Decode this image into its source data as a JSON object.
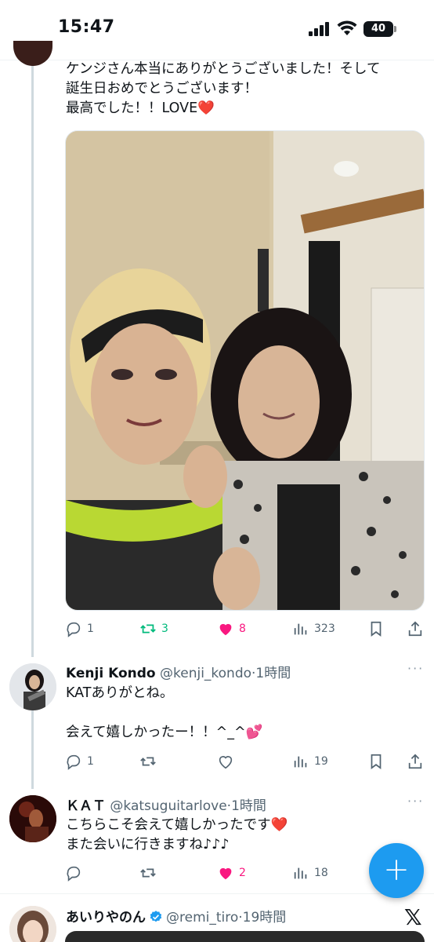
{
  "status_bar": {
    "time": "15:47",
    "battery": "40"
  },
  "tweet1": {
    "text": "ケンジさん本当にありがとうございました！そして\n誕生日おめでとうございます！\n最高でした！！LOVE❤️",
    "actions": {
      "replies": "1",
      "retweets": "3",
      "likes": "8",
      "views": "323"
    }
  },
  "tweet2": {
    "name": "Kenji Kondo",
    "handle": "@kenji_kondo",
    "time": "·1時間",
    "text": "KATありがとね。\n\n会えて嬉しかったー！！^_^💕",
    "actions": {
      "replies": "1",
      "retweets": "",
      "likes": "",
      "views": "19"
    }
  },
  "tweet3": {
    "name": "ＫＡＴ",
    "handle": "@katsuguitarlove",
    "time": "·1時間",
    "text": "こちらこそ会えて嬉しかったです❤️\nまた会いに行きますね♪♪♪",
    "actions": {
      "replies": "",
      "retweets": "",
      "likes": "2",
      "views": "18"
    }
  },
  "tweet4": {
    "name": "あいりやのん",
    "handle": "@remi_tiro",
    "time": "·19時間"
  },
  "more_label": "···",
  "fab_label": "+",
  "x_logo": "𝕏",
  "colors": {
    "accent": "#1d9bf0",
    "like": "#f91880",
    "retweet": "#00ba7c",
    "meta": "#536471"
  }
}
